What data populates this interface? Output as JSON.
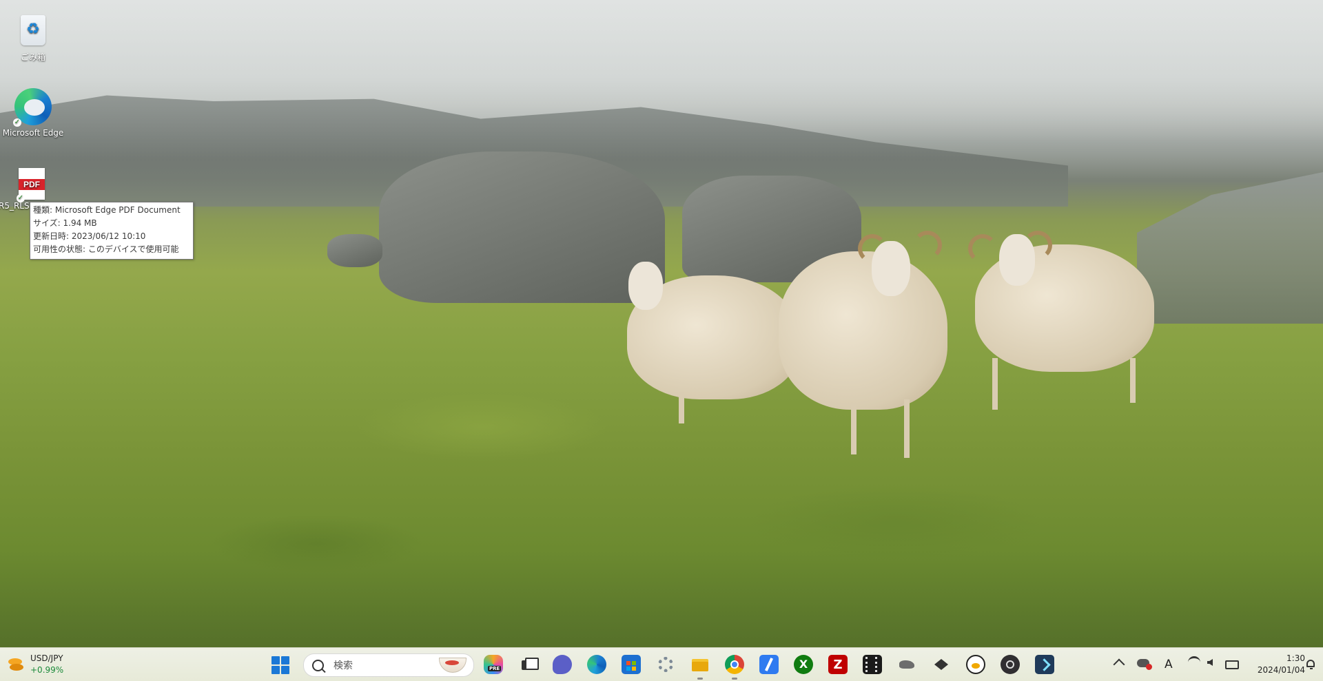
{
  "desktop": {
    "icons": [
      {
        "label": "ごみ箱",
        "name": "recycle-bin"
      },
      {
        "label": "Microsoft Edge",
        "name": "microsoft-edge"
      },
      {
        "label": "R5_RLS",
        "name": "pdf-document"
      }
    ],
    "pdf_icon_text": "PDF"
  },
  "tooltip": {
    "line1": "種類: Microsoft Edge PDF Document",
    "line2": "サイズ: 1.94 MB",
    "line3": "更新日時: 2023/06/12 10:10",
    "line4": "可用性の状態: このデバイスで使用可能"
  },
  "taskbar": {
    "widget": {
      "pair": "USD/JPY",
      "change": "+0.99%"
    },
    "search_placeholder": "検索",
    "apps": [
      "copilot-icon",
      "task-view-icon",
      "teams-chat-icon",
      "edge-icon",
      "store-icon",
      "settings-icon",
      "file-explorer-icon",
      "chrome-icon",
      "notes-icon",
      "xbox-icon",
      "filezilla-icon",
      "video-editor-icon",
      "game-icon",
      "app-icon",
      "linux-icon",
      "obs-icon",
      "terminal-icon"
    ],
    "copilot_badge": "PRE",
    "filezilla_letter": "Z",
    "xbox_letter": "X"
  },
  "tray": {
    "ime": "A",
    "time": "1:30",
    "date": "2024/01/04"
  },
  "colors": {
    "taskbar_bg": "#eef0e5",
    "accent": "#1b78d6",
    "change_positive": "#1b8a3a"
  }
}
